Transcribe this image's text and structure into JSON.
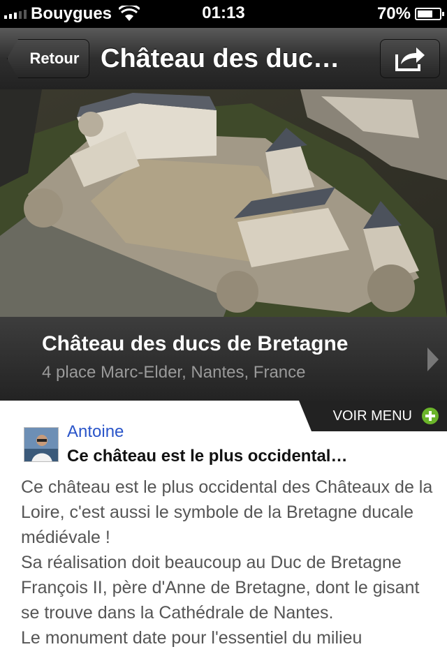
{
  "status_bar": {
    "carrier": "Bouygues",
    "time": "01:13",
    "battery_text": "70%",
    "battery_level": 0.7
  },
  "nav": {
    "back_label": "Retour",
    "title": "Château des duc…",
    "share_icon": "share-icon"
  },
  "place": {
    "name": "Château des ducs de Bretagne",
    "address": "4 place Marc-Elder, Nantes, France"
  },
  "menu_tab": {
    "label": "VOIR MENU"
  },
  "review": {
    "author": "Antoine",
    "headline": "Ce château est le plus occidental…",
    "paragraphs": [
      "Ce château est le plus occidental des Châteaux de la Loire, c'est aussi le symbole de la Bretagne ducale médiévale !",
      "Sa réalisation doit beaucoup au Duc de Bretagne François II, père d'Anne de Bretagne, dont le gisant se trouve dans la Cathédrale de Nantes.",
      "Le monument date pour l'essentiel du milieu"
    ]
  },
  "colors": {
    "link_blue": "#2a55c9",
    "plus_green": "#6bb52a"
  }
}
